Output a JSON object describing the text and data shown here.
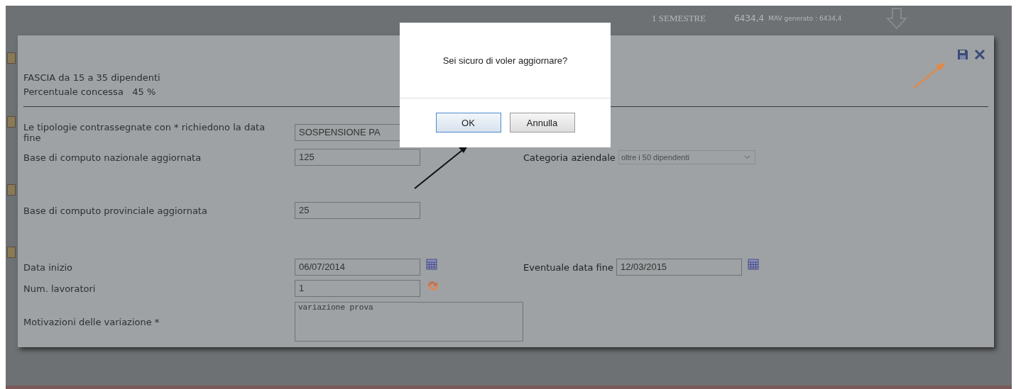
{
  "header": {
    "period": "1 SEMESTRE",
    "amount": "6434,4",
    "mav": "MAV generato : 6434,4"
  },
  "panel": {
    "info": [
      "FASCIA da 15 a 35 dipendenti",
      "Percentuale concessa   45 %"
    ],
    "rows": [
      {
        "left": {
          "label": "Le tipologie contrassegnate con * richiedono la data fine",
          "value": "SOSPENSIONE PA",
          "kind": "input"
        }
      },
      {
        "left": {
          "label": "Base di computo nazionale aggiornata",
          "value": "125",
          "kind": "input"
        },
        "right": {
          "label": "Categoria aziendale",
          "value": "oltre i 50 dipendenti",
          "kind": "select"
        }
      },
      {
        "left": {
          "label": "Base di computo provinciale aggiornata",
          "value": "25",
          "kind": "input"
        }
      },
      {
        "left": {
          "label": "Data inizio",
          "value": "06/07/2014",
          "kind": "date"
        },
        "right": {
          "label": "Eventuale data fine",
          "value": "12/03/2015",
          "kind": "date"
        }
      },
      {
        "left": {
          "label": "Num. lavoratori",
          "value": "1",
          "kind": "count"
        }
      },
      {
        "left": {
          "label": "Motivazioni delle variazione *",
          "value": "variazione prova",
          "kind": "textarea"
        }
      }
    ]
  },
  "dialog": {
    "message": "Sei sicuro di voler aggiornare?",
    "buttons": [
      {
        "label": "OK",
        "focused": true
      },
      {
        "label": "Annulla",
        "focused": false
      }
    ]
  }
}
